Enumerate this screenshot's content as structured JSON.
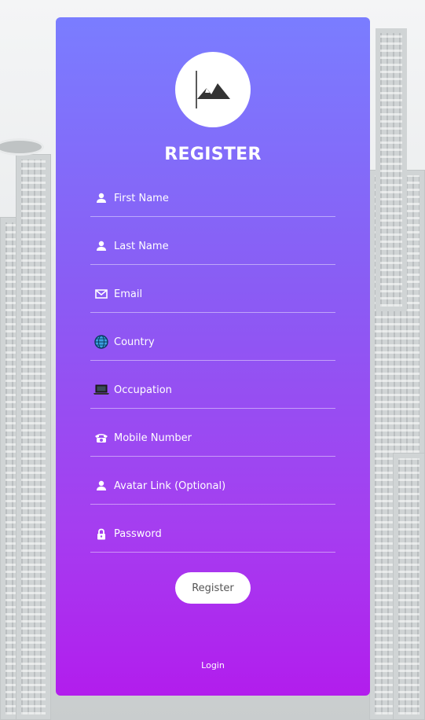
{
  "form": {
    "title": "REGISTER",
    "fields": [
      {
        "name": "first-name",
        "placeholder": "First Name",
        "icon": "user-icon"
      },
      {
        "name": "last-name",
        "placeholder": "Last Name",
        "icon": "user-icon"
      },
      {
        "name": "email",
        "placeholder": "Email",
        "icon": "envelope-icon"
      },
      {
        "name": "country",
        "placeholder": "Country",
        "icon": "globe-icon"
      },
      {
        "name": "occupation",
        "placeholder": "Occupation",
        "icon": "laptop-icon"
      },
      {
        "name": "mobile",
        "placeholder": "Mobile Number",
        "icon": "phone-icon"
      },
      {
        "name": "avatar",
        "placeholder": "Avatar Link (Optional)",
        "icon": "user-icon"
      },
      {
        "name": "password",
        "placeholder": "Password",
        "icon": "lock-icon"
      }
    ],
    "register_label": "Register",
    "login_label": "Login"
  },
  "colors": {
    "gradient_top": "#7a7dff",
    "gradient_bottom": "#b21ded",
    "button_bg": "#ffffff",
    "text": "#ffffff"
  }
}
